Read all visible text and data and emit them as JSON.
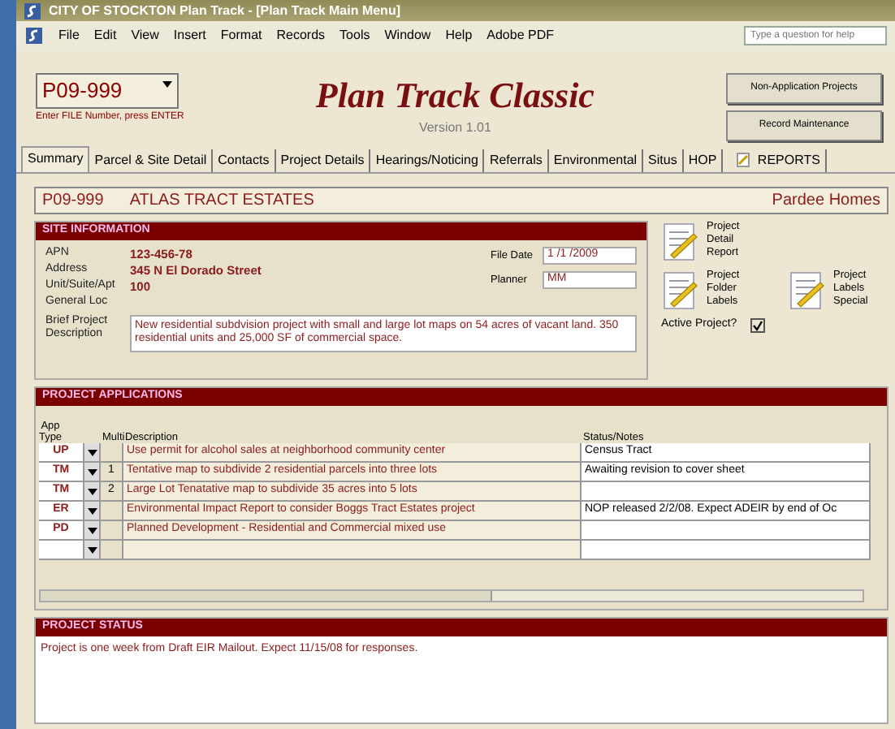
{
  "window": {
    "title": "CITY OF STOCKTON Plan Track - [Plan Track Main Menu]"
  },
  "menu": [
    "File",
    "Edit",
    "View",
    "Insert",
    "Format",
    "Records",
    "Tools",
    "Window",
    "Help",
    "Adobe PDF"
  ],
  "help_box": {
    "placeholder": "Type a question for help"
  },
  "file_field": {
    "value": "P09-999",
    "hint": "Enter FILE Number, press ENTER"
  },
  "app_title": "Plan Track Classic",
  "version": "Version 1.01",
  "buttons": [
    "Non-Application Projects",
    "Record Maintenance"
  ],
  "tabs": [
    {
      "label": "Summary",
      "selected": true
    },
    {
      "label": "Parcel & Site Detail",
      "selected": false
    },
    {
      "label": "Contacts",
      "selected": false
    },
    {
      "label": "Project Details",
      "selected": false
    },
    {
      "label": "Hearings/Noticing",
      "selected": false
    },
    {
      "label": "Referrals",
      "selected": false
    },
    {
      "label": "Environmental",
      "selected": false
    },
    {
      "label": "Situs",
      "selected": false
    },
    {
      "label": "HOP",
      "selected": false
    },
    {
      "label": "REPORTS",
      "selected": false,
      "kind": "icon"
    }
  ],
  "project": {
    "number": "P09-999",
    "name": "ATLAS TRACT ESTATES",
    "developer": "Pardee Homes"
  },
  "site_information": {
    "title": "SITE INFORMATION",
    "fields": [
      {
        "label": "APN",
        "value": "123-456-78"
      },
      {
        "label": "Address",
        "value": "345 N El Dorado Street"
      },
      {
        "label": "Unit/Suite/Apt",
        "value": "100"
      },
      {
        "label": "General Loc"
      }
    ],
    "file_date": {
      "label": "File Date",
      "value": "1 /1 /2009"
    },
    "planner": {
      "label": "Planner",
      "value": "MM"
    },
    "description": {
      "label": "Brief Project Description",
      "value": "New residential subdvision project with small and large lot maps on 54 acres of vacant land.  350 residential units and 25,000 SF of commercial space."
    }
  },
  "reports": [
    "Project Detail Report",
    "Project Folder Labels",
    "Project Labels Special"
  ],
  "active_project": {
    "label": "Active Project?",
    "checked": true
  },
  "applications": {
    "title": "PROJECT APPLICATIONS",
    "columns": [
      "App Type",
      "Multi",
      "Description",
      "Status/Notes"
    ],
    "rows": [
      {
        "type": "UP",
        "description": "Use permit for alcohol sales at neighborhood community center",
        "status": "Census Tract"
      },
      {
        "type": "TM",
        "multi": "1",
        "description": "Tentative map to subdivide 2 residential parcels into three lots",
        "status": "Awaiting revision to cover sheet"
      },
      {
        "type": "TM",
        "multi": "2",
        "description": "Large Lot Tenatative map to subdivide 35 acres into 5 lots"
      },
      {
        "type": "ER",
        "description": "Environmental Impact Report to consider Boggs Tract Estates project",
        "status": "NOP released 2/2/08.  Expect ADEIR by end of Oc"
      },
      {
        "type": "PD",
        "description": "Planned Development - Residential and Commercial mixed use"
      }
    ]
  },
  "status": {
    "title": "PROJECT STATUS",
    "text": "Project is one week from Draft EIR Mailout.  Expect 11/15/08 for responses."
  }
}
